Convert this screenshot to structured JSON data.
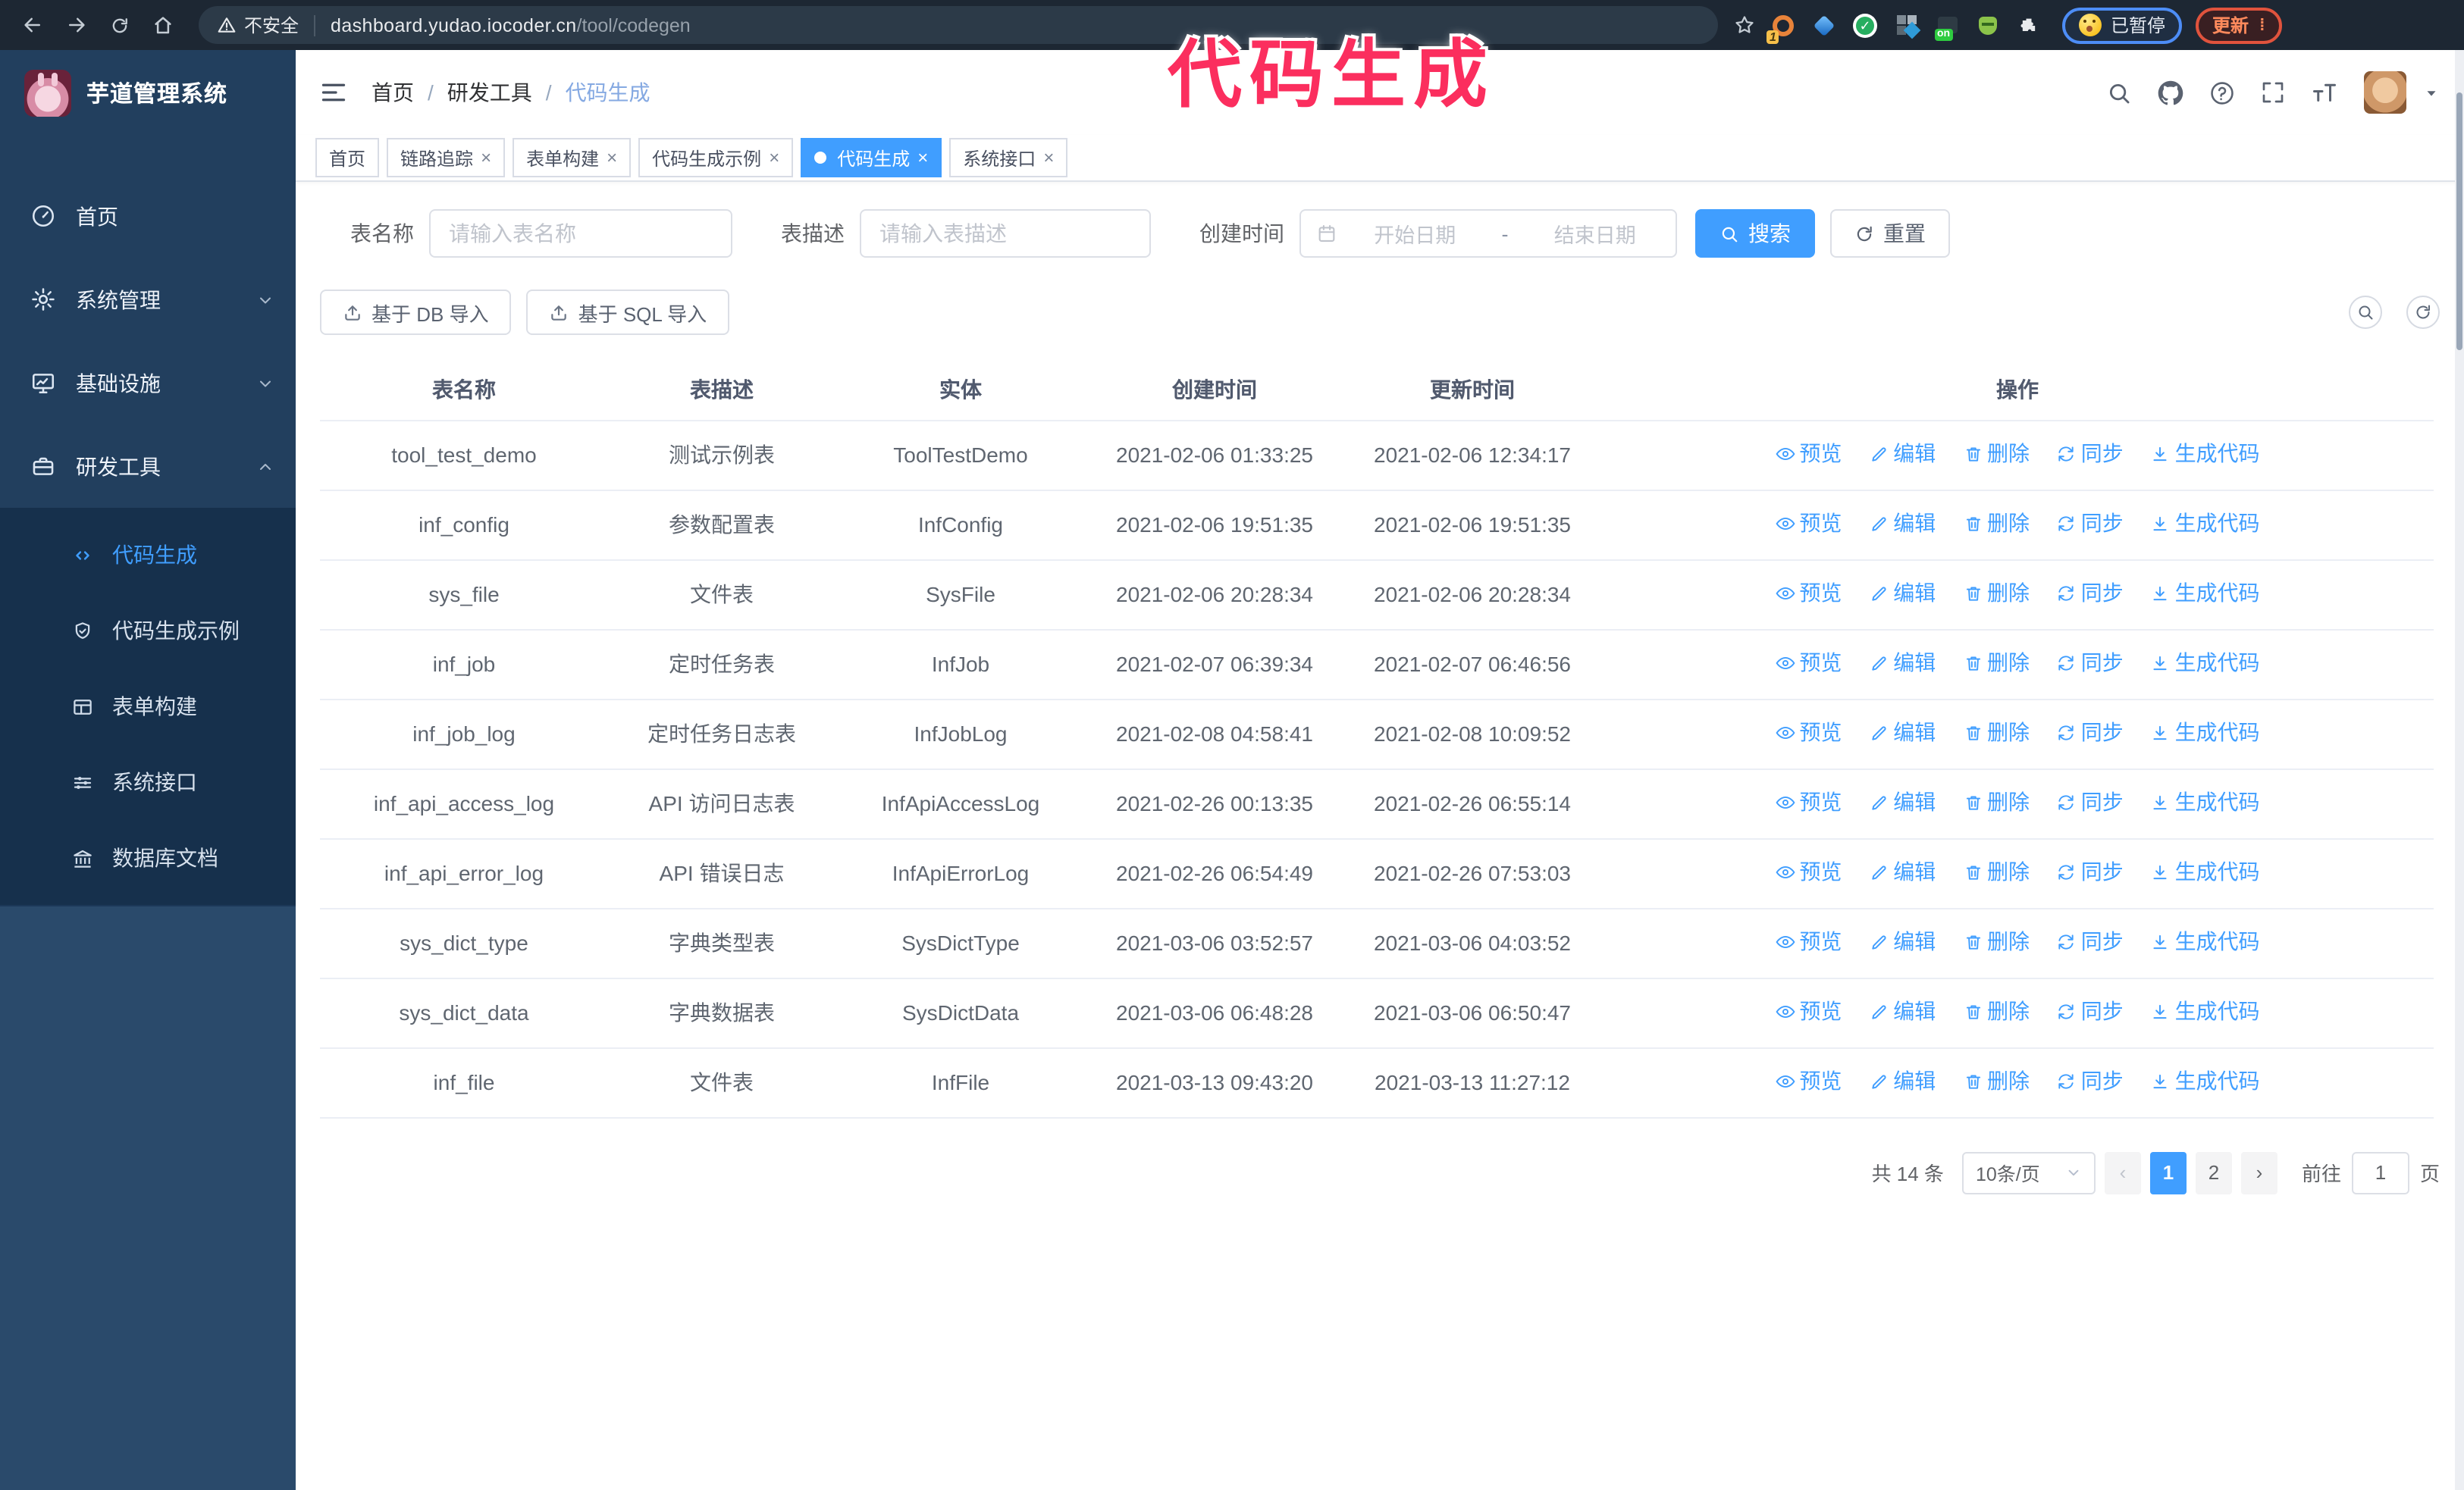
{
  "browser": {
    "security_label": "不安全",
    "url_host": "dashboard.yudao.iocoder.cn",
    "url_path": "/tool/codegen",
    "paused_badge": "已暂停",
    "update_button": "更新"
  },
  "annotation": {
    "overlay_title": "代码生成"
  },
  "sidebar": {
    "app_title": "芋道管理系统",
    "menu": [
      {
        "label": "首页",
        "icon": "dashboard-icon"
      },
      {
        "label": "系统管理",
        "icon": "gear-icon"
      },
      {
        "label": "基础设施",
        "icon": "monitor-icon"
      },
      {
        "label": "研发工具",
        "icon": "toolbox-icon"
      }
    ],
    "submenu": [
      {
        "label": "代码生成",
        "icon": "code-icon",
        "active": true
      },
      {
        "label": "代码生成示例",
        "icon": "shield-check-icon"
      },
      {
        "label": "表单构建",
        "icon": "form-icon"
      },
      {
        "label": "系统接口",
        "icon": "sliders-icon"
      },
      {
        "label": "数据库文档",
        "icon": "database-icon"
      }
    ]
  },
  "header": {
    "breadcrumb": [
      "首页",
      "研发工具",
      "代码生成"
    ],
    "tabs": [
      {
        "label": "首页"
      },
      {
        "label": "链路追踪"
      },
      {
        "label": "表单构建"
      },
      {
        "label": "代码生成示例"
      },
      {
        "label": "代码生成"
      },
      {
        "label": "系统接口"
      }
    ]
  },
  "filters": {
    "table_name": {
      "label": "表名称",
      "placeholder": "请输入表名称"
    },
    "table_desc": {
      "label": "表描述",
      "placeholder": "请输入表描述"
    },
    "create_time": {
      "label": "创建时间",
      "start_placeholder": "开始日期",
      "separator": "-",
      "end_placeholder": "结束日期"
    },
    "search_label": "搜索",
    "reset_label": "重置"
  },
  "toolbar": {
    "import_db_label": "基于 DB 导入",
    "import_sql_label": "基于 SQL 导入"
  },
  "table": {
    "columns": [
      "表名称",
      "表描述",
      "实体",
      "创建时间",
      "更新时间",
      "操作"
    ],
    "actions": [
      "预览",
      "编辑",
      "删除",
      "同步",
      "生成代码"
    ],
    "rows": [
      {
        "name": "tool_test_demo",
        "desc": "测试示例表",
        "entity": "ToolTestDemo",
        "created": "2021-02-06 01:33:25",
        "updated": "2021-02-06 12:34:17"
      },
      {
        "name": "inf_config",
        "desc": "参数配置表",
        "entity": "InfConfig",
        "created": "2021-02-06 19:51:35",
        "updated": "2021-02-06 19:51:35"
      },
      {
        "name": "sys_file",
        "desc": "文件表",
        "entity": "SysFile",
        "created": "2021-02-06 20:28:34",
        "updated": "2021-02-06 20:28:34"
      },
      {
        "name": "inf_job",
        "desc": "定时任务表",
        "entity": "InfJob",
        "created": "2021-02-07 06:39:34",
        "updated": "2021-02-07 06:46:56"
      },
      {
        "name": "inf_job_log",
        "desc": "定时任务日志表",
        "entity": "InfJobLog",
        "created": "2021-02-08 04:58:41",
        "updated": "2021-02-08 10:09:52"
      },
      {
        "name": "inf_api_access_log",
        "desc": "API 访问日志表",
        "entity": "InfApiAccessLog",
        "created": "2021-02-26 00:13:35",
        "updated": "2021-02-26 06:55:14"
      },
      {
        "name": "inf_api_error_log",
        "desc": "API 错误日志",
        "entity": "InfApiErrorLog",
        "created": "2021-02-26 06:54:49",
        "updated": "2021-02-26 07:53:03"
      },
      {
        "name": "sys_dict_type",
        "desc": "字典类型表",
        "entity": "SysDictType",
        "created": "2021-03-06 03:52:57",
        "updated": "2021-03-06 04:03:52"
      },
      {
        "name": "sys_dict_data",
        "desc": "字典数据表",
        "entity": "SysDictData",
        "created": "2021-03-06 06:48:28",
        "updated": "2021-03-06 06:50:47"
      },
      {
        "name": "inf_file",
        "desc": "文件表",
        "entity": "InfFile",
        "created": "2021-03-13 09:43:20",
        "updated": "2021-03-13 11:27:12"
      }
    ]
  },
  "pagination": {
    "total_label": "共 14 条",
    "page_size_label": "10条/页",
    "pages": [
      "1",
      "2"
    ],
    "active_page": "1",
    "goto_label": "前往",
    "goto_value": "1",
    "goto_suffix": "页"
  },
  "colors": {
    "accent_blue": "#409eff",
    "annotation_pink": "#fb2e5e",
    "chrome_bg": "#1d2733",
    "sidebar_bg": "#223f5e",
    "submenu_bg": "#16304c",
    "sidebar_lower_bg": "#2a4a6b"
  }
}
